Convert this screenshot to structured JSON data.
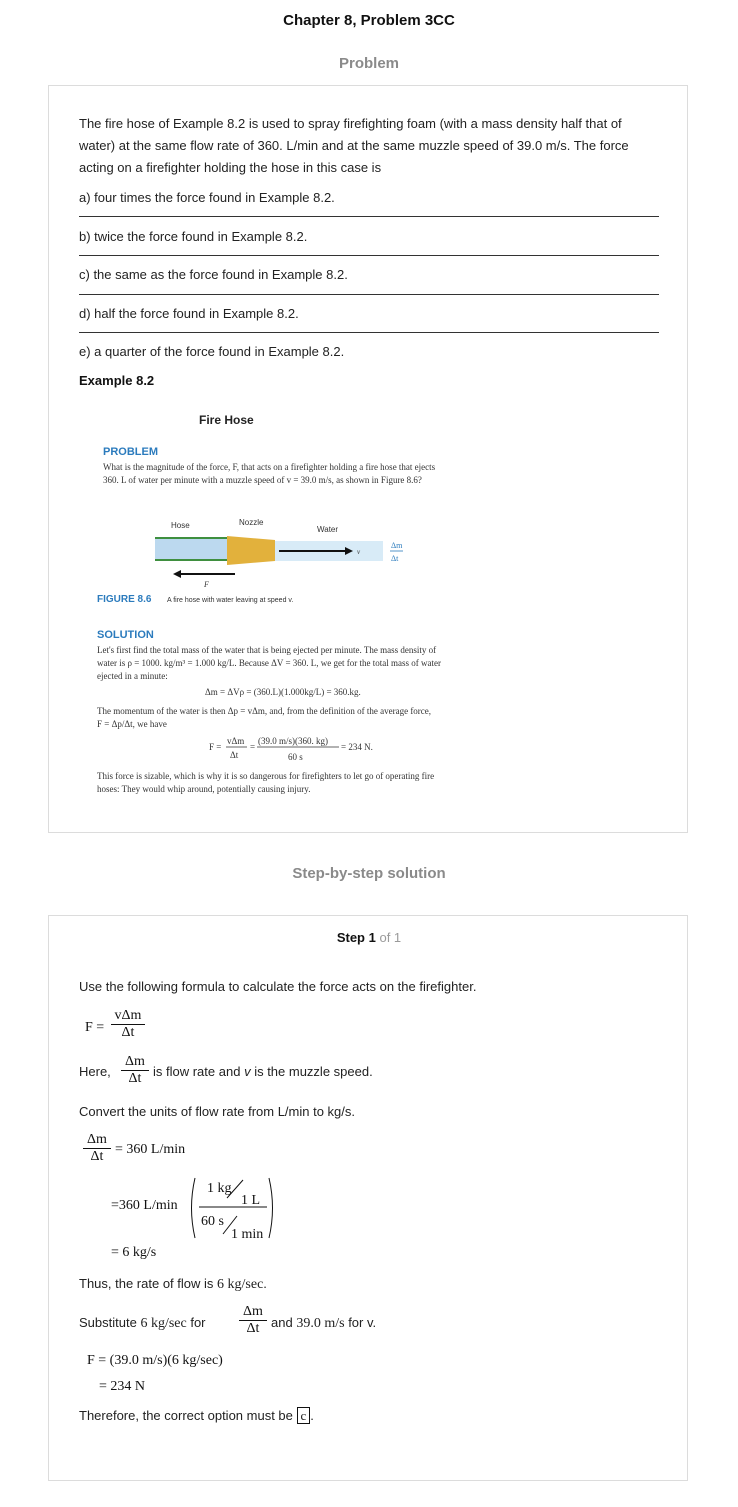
{
  "header": {
    "title": "Chapter 8, Problem 3CC"
  },
  "problem": {
    "heading": "Problem",
    "question": "The fire hose of Example 8.2 is used to spray firefighting foam (with a mass density half that of water) at the same flow rate of 360. L/min and at the same muzzle speed of 39.0 m/s. The force acting on a firefighter holding the hose in this case is",
    "options": [
      "a) four times the force found in Example 8.2.",
      "b) twice the force found in Example 8.2.",
      "c) the same as the force found in Example 8.2.",
      "d) half the force found in Example 8.2.",
      "e) a quarter of the force found in Example 8.2."
    ],
    "example_heading": "Example 8.2",
    "example": {
      "title": "Fire Hose",
      "problem_label": "PROBLEM",
      "problem_text_1": "What is the magnitude of the force, F, that acts on a firefighter holding a fire hose that ejects",
      "problem_text_2": "360. L of water per minute with a muzzle speed of v = 39.0 m/s, as shown in Figure 8.6?",
      "fig_hose": "Hose",
      "fig_nozzle": "Nozzle",
      "fig_water": "Water",
      "fig_v": "v",
      "fig_F": "F",
      "fig_dm": "Δm",
      "fig_dt": "Δt",
      "figure_label": "FIGURE 8.6",
      "figure_caption": "A fire hose with water leaving at speed v.",
      "solution_label": "SOLUTION",
      "sol_1": "Let's first find the total mass of the water that is being ejected per minute. The mass density of",
      "sol_2": "water is ρ = 1000. kg/m³ = 1.000 kg/L. Because ΔV = 360. L, we get for the total mass of water",
      "sol_3": "ejected in a minute:",
      "eq_1": "Δm = ΔVρ = (360.L)(1.000kg/L) = 360.kg.",
      "sol_4": "The momentum of the water is then Δp = vΔm, and, from the definition of the average force,",
      "sol_5": "F = Δp/Δt, we have",
      "eq_F": "F =",
      "eq_num1": "vΔm",
      "eq_den1": "Δt",
      "eq_eq": "=",
      "eq_num2": "(39.0 m/s)(360. kg)",
      "eq_den2": "60 s",
      "eq_result": "= 234 N.",
      "sol_6": "This force is sizable, which is why it is so dangerous for firefighters to let go of operating fire",
      "sol_7": "hoses: They would whip around, potentially causing injury."
    }
  },
  "solution": {
    "heading": "Step-by-step solution",
    "step_label": "Step 1",
    "step_of": "of 1",
    "intro": "Use the following formula to calculate the force acts on the firefighter.",
    "F_eq": "F =",
    "vdm": "vΔm",
    "dt": "Δt",
    "dm": "Δm",
    "here": "Here,",
    "here_rest_1": "is flow rate and",
    "here_v": "v",
    "here_rest_2": "is the muzzle speed.",
    "convert": "Convert the units of flow rate from L/min to kg/s.",
    "flow_eq": "= 360 L/min",
    "conv_lhs": "=360 L/min",
    "conv_num": "1 kg",
    "conv_num_den": "1 L",
    "conv_den": "60 s",
    "conv_den_den": "1 min",
    "conv_result": "= 6 kg/s",
    "thus": "Thus, the rate of flow is",
    "thus_val": "6 kg/sec",
    "thus_end": ".",
    "sub_1": "Substitute",
    "sub_val": "6 kg/sec",
    "sub_for": "for",
    "sub_and": "and",
    "sub_speed": "39.0 m/s",
    "sub_for_v": "for v.",
    "final_1": "F = (39.0 m/s)(6 kg/sec)",
    "final_2": "= 234 N",
    "therefore": "Therefore, the correct option must be",
    "answer": "c",
    "period": "."
  },
  "colors": {
    "heading_gray": "#8a8a8a",
    "card_border": "#dcdcdc",
    "fig_blue": "#2b7bbd",
    "nozzle_gold": "#e2b13c",
    "hose_green": "#3f8f3f"
  }
}
